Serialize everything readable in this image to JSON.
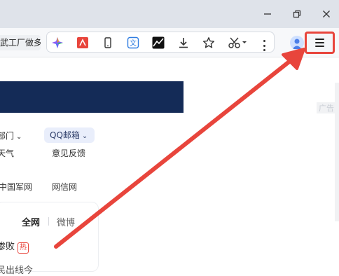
{
  "window": {
    "minimize_label": "minimize-icon",
    "restore_label": "restore-icon",
    "close_label": "close-icon"
  },
  "toolbar": {
    "url_fragment": "武工厂做多",
    "extensions": [
      "ai-sparkle-icon",
      "pdf-icon",
      "phone-icon",
      "translate-icon",
      "stock-chart-icon",
      "download-icon",
      "star-icon",
      "scissors-icon"
    ],
    "more_label": "more-icon",
    "menu_label": "menu-icon"
  },
  "page": {
    "ad_label": "广告",
    "nav": {
      "dept": "部门",
      "qq_mail": "QQ邮箱",
      "weather": "天气",
      "feedback": "意见反馈",
      "military": "中国军网",
      "netinfo": "网信网"
    },
    "hot": {
      "tab_all": "全网",
      "tab_weibo": "微博",
      "item1": "惨败",
      "item1_badge": "热",
      "item2": "民出线今"
    }
  },
  "colors": {
    "accent_red": "#e8453c",
    "banner_navy": "#142b57"
  }
}
